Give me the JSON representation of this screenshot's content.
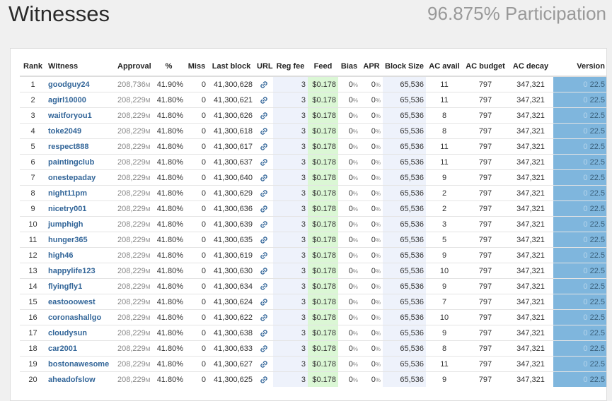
{
  "header": {
    "title": "Witnesses",
    "participation": "96.875% Participation"
  },
  "table": {
    "columns": [
      "Rank",
      "Witness",
      "Approval",
      "%",
      "Miss",
      "Last block",
      "URL",
      "Reg fee",
      "Feed",
      "Bias",
      "APR",
      "Block Size",
      "AC avail",
      "AC budget",
      "AC decay",
      "Version"
    ],
    "url_icon": "link-icon",
    "colors": {
      "feed_bg": "#dbf7d5",
      "version_bg": "#7fb6dd",
      "reg_bg": "#eef2fb",
      "link": "#336699"
    },
    "rows": [
      {
        "rank": "1",
        "witness": "goodguy24",
        "approval": "208,736",
        "approval_unit": "M",
        "pct": "41.90%",
        "miss": "0",
        "last_block": "41,300,628",
        "reg_fee": "3",
        "feed": "$0.178",
        "bias": "0",
        "bias_unit": "%",
        "apr": "0",
        "apr_unit": "%",
        "block_size": "65,536",
        "ac_avail": "11",
        "ac_budget": "797",
        "ac_decay": "347,321",
        "version_zero": "0",
        "version": "22.5"
      },
      {
        "rank": "2",
        "witness": "agirl10000",
        "approval": "208,229",
        "approval_unit": "M",
        "pct": "41.80%",
        "miss": "0",
        "last_block": "41,300,621",
        "reg_fee": "3",
        "feed": "$0.178",
        "bias": "0",
        "bias_unit": "%",
        "apr": "0",
        "apr_unit": "%",
        "block_size": "65,536",
        "ac_avail": "11",
        "ac_budget": "797",
        "ac_decay": "347,321",
        "version_zero": "0",
        "version": "22.5"
      },
      {
        "rank": "3",
        "witness": "waitforyou1",
        "approval": "208,229",
        "approval_unit": "M",
        "pct": "41.80%",
        "miss": "0",
        "last_block": "41,300,626",
        "reg_fee": "3",
        "feed": "$0.178",
        "bias": "0",
        "bias_unit": "%",
        "apr": "0",
        "apr_unit": "%",
        "block_size": "65,536",
        "ac_avail": "8",
        "ac_budget": "797",
        "ac_decay": "347,321",
        "version_zero": "0",
        "version": "22.5"
      },
      {
        "rank": "4",
        "witness": "toke2049",
        "approval": "208,229",
        "approval_unit": "M",
        "pct": "41.80%",
        "miss": "0",
        "last_block": "41,300,618",
        "reg_fee": "3",
        "feed": "$0.178",
        "bias": "0",
        "bias_unit": "%",
        "apr": "0",
        "apr_unit": "%",
        "block_size": "65,536",
        "ac_avail": "8",
        "ac_budget": "797",
        "ac_decay": "347,321",
        "version_zero": "0",
        "version": "22.5"
      },
      {
        "rank": "5",
        "witness": "respect888",
        "approval": "208,229",
        "approval_unit": "M",
        "pct": "41.80%",
        "miss": "0",
        "last_block": "41,300,617",
        "reg_fee": "3",
        "feed": "$0.178",
        "bias": "0",
        "bias_unit": "%",
        "apr": "0",
        "apr_unit": "%",
        "block_size": "65,536",
        "ac_avail": "11",
        "ac_budget": "797",
        "ac_decay": "347,321",
        "version_zero": "0",
        "version": "22.5"
      },
      {
        "rank": "6",
        "witness": "paintingclub",
        "approval": "208,229",
        "approval_unit": "M",
        "pct": "41.80%",
        "miss": "0",
        "last_block": "41,300,637",
        "reg_fee": "3",
        "feed": "$0.178",
        "bias": "0",
        "bias_unit": "%",
        "apr": "0",
        "apr_unit": "%",
        "block_size": "65,536",
        "ac_avail": "11",
        "ac_budget": "797",
        "ac_decay": "347,321",
        "version_zero": "0",
        "version": "22.5"
      },
      {
        "rank": "7",
        "witness": "onestepaday",
        "approval": "208,229",
        "approval_unit": "M",
        "pct": "41.80%",
        "miss": "0",
        "last_block": "41,300,640",
        "reg_fee": "3",
        "feed": "$0.178",
        "bias": "0",
        "bias_unit": "%",
        "apr": "0",
        "apr_unit": "%",
        "block_size": "65,536",
        "ac_avail": "9",
        "ac_budget": "797",
        "ac_decay": "347,321",
        "version_zero": "0",
        "version": "22.5"
      },
      {
        "rank": "8",
        "witness": "night11pm",
        "approval": "208,229",
        "approval_unit": "M",
        "pct": "41.80%",
        "miss": "0",
        "last_block": "41,300,629",
        "reg_fee": "3",
        "feed": "$0.178",
        "bias": "0",
        "bias_unit": "%",
        "apr": "0",
        "apr_unit": "%",
        "block_size": "65,536",
        "ac_avail": "2",
        "ac_budget": "797",
        "ac_decay": "347,321",
        "version_zero": "0",
        "version": "22.5"
      },
      {
        "rank": "9",
        "witness": "nicetry001",
        "approval": "208,229",
        "approval_unit": "M",
        "pct": "41.80%",
        "miss": "0",
        "last_block": "41,300,636",
        "reg_fee": "3",
        "feed": "$0.178",
        "bias": "0",
        "bias_unit": "%",
        "apr": "0",
        "apr_unit": "%",
        "block_size": "65,536",
        "ac_avail": "2",
        "ac_budget": "797",
        "ac_decay": "347,321",
        "version_zero": "0",
        "version": "22.5"
      },
      {
        "rank": "10",
        "witness": "jumphigh",
        "approval": "208,229",
        "approval_unit": "M",
        "pct": "41.80%",
        "miss": "0",
        "last_block": "41,300,639",
        "reg_fee": "3",
        "feed": "$0.178",
        "bias": "0",
        "bias_unit": "%",
        "apr": "0",
        "apr_unit": "%",
        "block_size": "65,536",
        "ac_avail": "3",
        "ac_budget": "797",
        "ac_decay": "347,321",
        "version_zero": "0",
        "version": "22.5"
      },
      {
        "rank": "11",
        "witness": "hunger365",
        "approval": "208,229",
        "approval_unit": "M",
        "pct": "41.80%",
        "miss": "0",
        "last_block": "41,300,635",
        "reg_fee": "3",
        "feed": "$0.178",
        "bias": "0",
        "bias_unit": "%",
        "apr": "0",
        "apr_unit": "%",
        "block_size": "65,536",
        "ac_avail": "5",
        "ac_budget": "797",
        "ac_decay": "347,321",
        "version_zero": "0",
        "version": "22.5"
      },
      {
        "rank": "12",
        "witness": "high46",
        "approval": "208,229",
        "approval_unit": "M",
        "pct": "41.80%",
        "miss": "0",
        "last_block": "41,300,619",
        "reg_fee": "3",
        "feed": "$0.178",
        "bias": "0",
        "bias_unit": "%",
        "apr": "0",
        "apr_unit": "%",
        "block_size": "65,536",
        "ac_avail": "9",
        "ac_budget": "797",
        "ac_decay": "347,321",
        "version_zero": "0",
        "version": "22.5"
      },
      {
        "rank": "13",
        "witness": "happylife123",
        "approval": "208,229",
        "approval_unit": "M",
        "pct": "41.80%",
        "miss": "0",
        "last_block": "41,300,630",
        "reg_fee": "3",
        "feed": "$0.178",
        "bias": "0",
        "bias_unit": "%",
        "apr": "0",
        "apr_unit": "%",
        "block_size": "65,536",
        "ac_avail": "10",
        "ac_budget": "797",
        "ac_decay": "347,321",
        "version_zero": "0",
        "version": "22.5"
      },
      {
        "rank": "14",
        "witness": "flyingfly1",
        "approval": "208,229",
        "approval_unit": "M",
        "pct": "41.80%",
        "miss": "0",
        "last_block": "41,300,634",
        "reg_fee": "3",
        "feed": "$0.178",
        "bias": "0",
        "bias_unit": "%",
        "apr": "0",
        "apr_unit": "%",
        "block_size": "65,536",
        "ac_avail": "9",
        "ac_budget": "797",
        "ac_decay": "347,321",
        "version_zero": "0",
        "version": "22.5"
      },
      {
        "rank": "15",
        "witness": "eastooowest",
        "approval": "208,229",
        "approval_unit": "M",
        "pct": "41.80%",
        "miss": "0",
        "last_block": "41,300,624",
        "reg_fee": "3",
        "feed": "$0.178",
        "bias": "0",
        "bias_unit": "%",
        "apr": "0",
        "apr_unit": "%",
        "block_size": "65,536",
        "ac_avail": "7",
        "ac_budget": "797",
        "ac_decay": "347,321",
        "version_zero": "0",
        "version": "22.5"
      },
      {
        "rank": "16",
        "witness": "coronashallgo",
        "approval": "208,229",
        "approval_unit": "M",
        "pct": "41.80%",
        "miss": "0",
        "last_block": "41,300,622",
        "reg_fee": "3",
        "feed": "$0.178",
        "bias": "0",
        "bias_unit": "%",
        "apr": "0",
        "apr_unit": "%",
        "block_size": "65,536",
        "ac_avail": "10",
        "ac_budget": "797",
        "ac_decay": "347,321",
        "version_zero": "0",
        "version": "22.5"
      },
      {
        "rank": "17",
        "witness": "cloudysun",
        "approval": "208,229",
        "approval_unit": "M",
        "pct": "41.80%",
        "miss": "0",
        "last_block": "41,300,638",
        "reg_fee": "3",
        "feed": "$0.178",
        "bias": "0",
        "bias_unit": "%",
        "apr": "0",
        "apr_unit": "%",
        "block_size": "65,536",
        "ac_avail": "9",
        "ac_budget": "797",
        "ac_decay": "347,321",
        "version_zero": "0",
        "version": "22.5"
      },
      {
        "rank": "18",
        "witness": "car2001",
        "approval": "208,229",
        "approval_unit": "M",
        "pct": "41.80%",
        "miss": "0",
        "last_block": "41,300,633",
        "reg_fee": "3",
        "feed": "$0.178",
        "bias": "0",
        "bias_unit": "%",
        "apr": "0",
        "apr_unit": "%",
        "block_size": "65,536",
        "ac_avail": "8",
        "ac_budget": "797",
        "ac_decay": "347,321",
        "version_zero": "0",
        "version": "22.5"
      },
      {
        "rank": "19",
        "witness": "bostonawesome",
        "approval": "208,229",
        "approval_unit": "M",
        "pct": "41.80%",
        "miss": "0",
        "last_block": "41,300,627",
        "reg_fee": "3",
        "feed": "$0.178",
        "bias": "0",
        "bias_unit": "%",
        "apr": "0",
        "apr_unit": "%",
        "block_size": "65,536",
        "ac_avail": "11",
        "ac_budget": "797",
        "ac_decay": "347,321",
        "version_zero": "0",
        "version": "22.5"
      },
      {
        "rank": "20",
        "witness": "aheadofslow",
        "approval": "208,229",
        "approval_unit": "M",
        "pct": "41.80%",
        "miss": "0",
        "last_block": "41,300,625",
        "reg_fee": "3",
        "feed": "$0.178",
        "bias": "0",
        "bias_unit": "%",
        "apr": "0",
        "apr_unit": "%",
        "block_size": "65,536",
        "ac_avail": "9",
        "ac_budget": "797",
        "ac_decay": "347,321",
        "version_zero": "0",
        "version": "22.5"
      }
    ]
  }
}
